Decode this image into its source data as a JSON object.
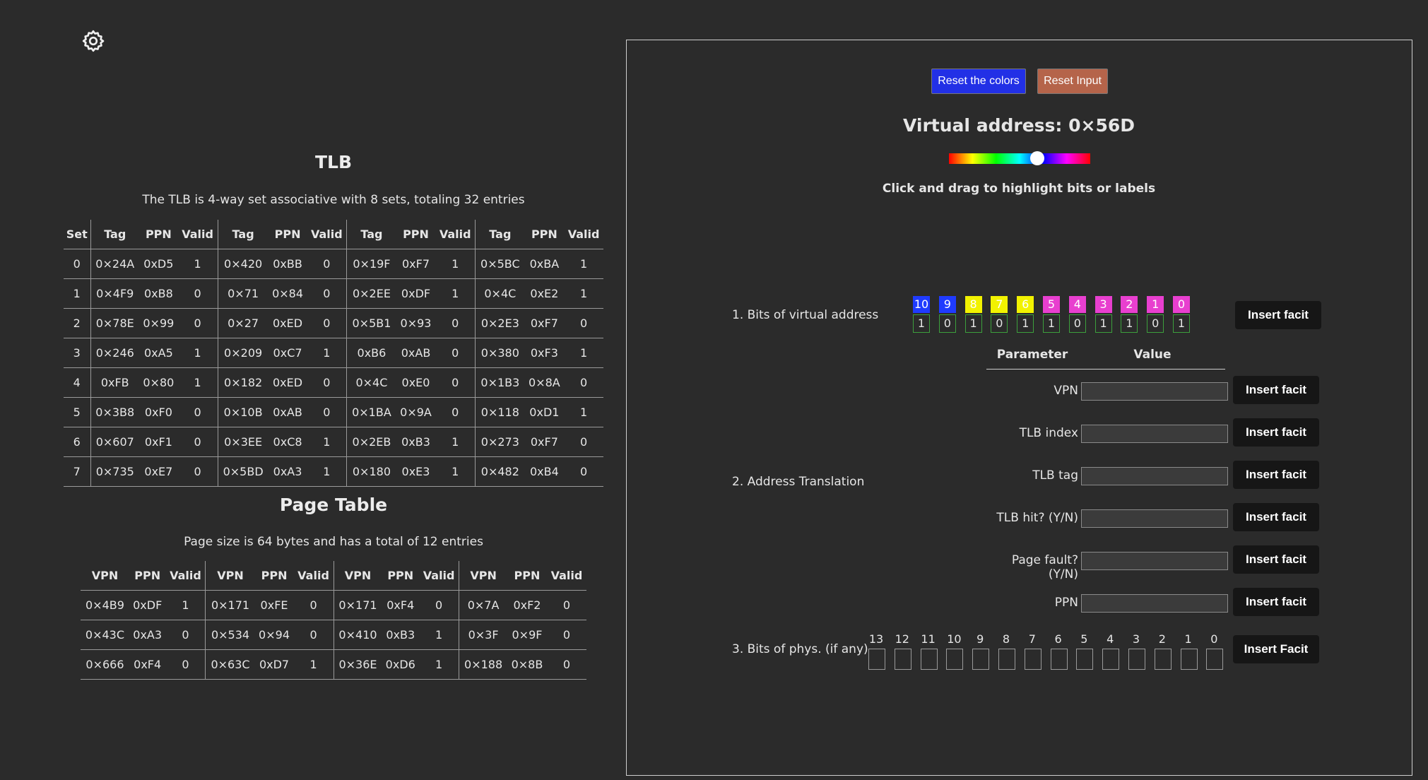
{
  "left": {
    "tlb": {
      "title": "TLB",
      "subtitle": "The TLB is 4-way set associative with 8 sets, totaling 32 entries",
      "headers": [
        "Set",
        "Tag",
        "PPN",
        "Valid",
        "Tag",
        "PPN",
        "Valid",
        "Tag",
        "PPN",
        "Valid",
        "Tag",
        "PPN",
        "Valid"
      ],
      "rows": [
        [
          "0",
          "0×24A",
          "0xD5",
          "1",
          "0×420",
          "0xBB",
          "0",
          "0×19F",
          "0xF7",
          "1",
          "0×5BC",
          "0xBA",
          "1"
        ],
        [
          "1",
          "0×4F9",
          "0xB8",
          "0",
          "0×71",
          "0×84",
          "0",
          "0×2EE",
          "0xDF",
          "1",
          "0×4C",
          "0xE2",
          "1"
        ],
        [
          "2",
          "0×78E",
          "0×99",
          "0",
          "0×27",
          "0xED",
          "0",
          "0×5B1",
          "0×93",
          "0",
          "0×2E3",
          "0xF7",
          "0"
        ],
        [
          "3",
          "0×246",
          "0xA5",
          "1",
          "0×209",
          "0xC7",
          "1",
          "0xB6",
          "0xAB",
          "0",
          "0×380",
          "0xF3",
          "1"
        ],
        [
          "4",
          "0xFB",
          "0×80",
          "1",
          "0×182",
          "0xED",
          "0",
          "0×4C",
          "0xE0",
          "0",
          "0×1B3",
          "0×8A",
          "0"
        ],
        [
          "5",
          "0×3B8",
          "0xF0",
          "0",
          "0×10B",
          "0xAB",
          "0",
          "0×1BA",
          "0×9A",
          "0",
          "0×118",
          "0xD1",
          "1"
        ],
        [
          "6",
          "0×607",
          "0xF1",
          "0",
          "0×3EE",
          "0xC8",
          "1",
          "0×2EB",
          "0xB3",
          "1",
          "0×273",
          "0xF7",
          "0"
        ],
        [
          "7",
          "0×735",
          "0xE7",
          "0",
          "0×5BD",
          "0xA3",
          "1",
          "0×180",
          "0xE3",
          "1",
          "0×482",
          "0xB4",
          "0"
        ]
      ]
    },
    "page_table": {
      "title": "Page Table",
      "subtitle": "Page size is 64 bytes and has a total of 12 entries",
      "headers": [
        "VPN",
        "PPN",
        "Valid",
        "VPN",
        "PPN",
        "Valid",
        "VPN",
        "PPN",
        "Valid",
        "VPN",
        "PPN",
        "Valid"
      ],
      "rows": [
        [
          "0×4B9",
          "0xDF",
          "1",
          "0×171",
          "0xFE",
          "0",
          "0×171",
          "0xF4",
          "0",
          "0×7A",
          "0xF2",
          "0"
        ],
        [
          "0×43C",
          "0xA3",
          "0",
          "0×534",
          "0×94",
          "0",
          "0×410",
          "0xB3",
          "1",
          "0×3F",
          "0×9F",
          "0"
        ],
        [
          "0×666",
          "0xF4",
          "0",
          "0×63C",
          "0xD7",
          "1",
          "0×36E",
          "0xD6",
          "1",
          "0×188",
          "0×8B",
          "0"
        ]
      ]
    }
  },
  "right": {
    "reset_colors_label": "Reset the colors",
    "reset_input_label": "Reset Input",
    "virtual_address_title": "Virtual address: 0×56D",
    "hue_slider_value": 0.62,
    "hint": "Click and drag to highlight bits or labels",
    "section1_label": "1. Bits of virtual address",
    "section2_label": "2. Address Translation",
    "section3_label": "3. Bits of phys. (if any)",
    "insert_fact_label": "Insert facit",
    "insert_fact_label_caps": "Insert Facit",
    "virtual_bits": [
      {
        "label": "10",
        "value": "1",
        "color": "#1f3bff"
      },
      {
        "label": "9",
        "value": "0",
        "color": "#1f3bff"
      },
      {
        "label": "8",
        "value": "1",
        "color": "#f2f200"
      },
      {
        "label": "7",
        "value": "0",
        "color": "#f2f200"
      },
      {
        "label": "6",
        "value": "1",
        "color": "#f2f200"
      },
      {
        "label": "5",
        "value": "1",
        "color": "#e83fcf"
      },
      {
        "label": "4",
        "value": "0",
        "color": "#e83fcf"
      },
      {
        "label": "3",
        "value": "1",
        "color": "#e83fcf"
      },
      {
        "label": "2",
        "value": "1",
        "color": "#e83fcf"
      },
      {
        "label": "1",
        "value": "0",
        "color": "#e83fcf"
      },
      {
        "label": "0",
        "value": "1",
        "color": "#e83fcf"
      }
    ],
    "param_header": "Parameter",
    "value_header": "Value",
    "params": [
      "VPN",
      "TLB index",
      "TLB tag",
      "TLB hit? (Y/N)",
      "Page fault? (Y/N)",
      "PPN"
    ],
    "phys_bits": [
      "13",
      "12",
      "11",
      "10",
      "9",
      "8",
      "7",
      "6",
      "5",
      "4",
      "3",
      "2",
      "1",
      "0"
    ]
  }
}
